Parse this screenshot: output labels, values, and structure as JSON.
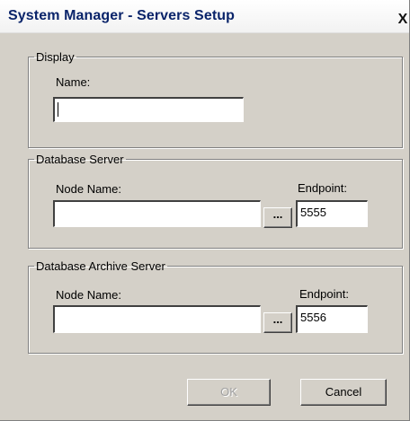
{
  "window": {
    "title": "System Manager - Servers Setup",
    "close_label": "X"
  },
  "display_group": {
    "legend": "Display",
    "name_label": "Name:",
    "name_value": ""
  },
  "database_server_group": {
    "legend": "Database Server",
    "node_name_label": "Node Name:",
    "node_name_value": "",
    "browse_label": "...",
    "endpoint_label": "Endpoint:",
    "endpoint_value": "5555"
  },
  "database_archive_group": {
    "legend": "Database Archive Server",
    "node_name_label": "Node Name:",
    "node_name_value": "",
    "browse_label": "...",
    "endpoint_label": "Endpoint:",
    "endpoint_value": "5556"
  },
  "buttons": {
    "ok_label": "OK",
    "ok_enabled": false,
    "cancel_label": "Cancel"
  },
  "colors": {
    "dialog_face": "#d4d0c8",
    "title_text": "#0a246a",
    "disabled_text": "#a0a0a0"
  }
}
